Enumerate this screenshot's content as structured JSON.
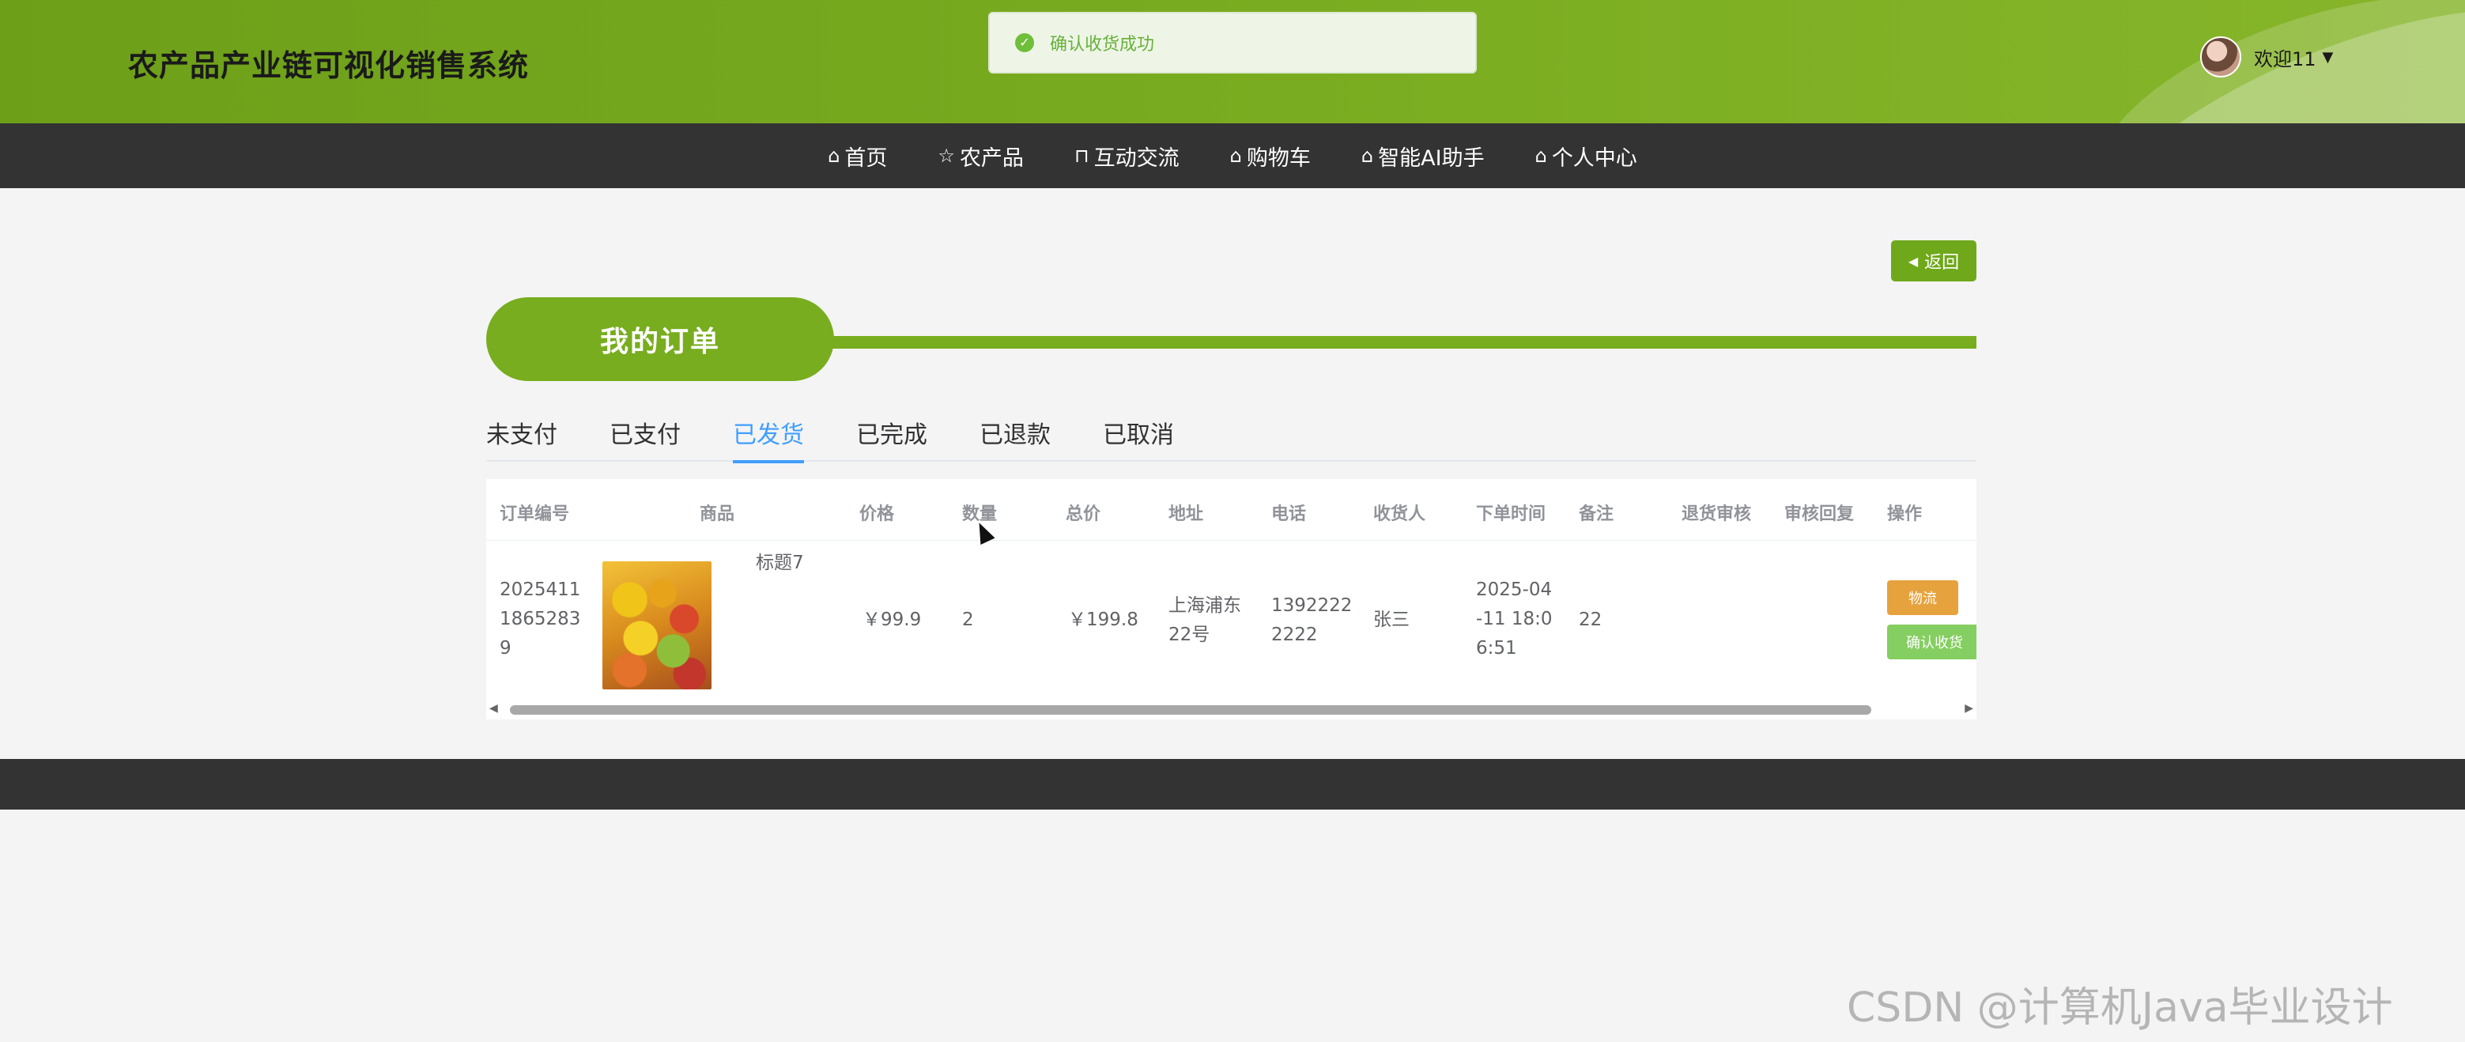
{
  "app": {
    "title": "农产品产业链可视化销售系统",
    "welcome": "欢迎11"
  },
  "toast": {
    "message": "确认收货成功",
    "icon": "check-circle-icon"
  },
  "nav": {
    "items": [
      {
        "label": "首页",
        "icon": "home-icon"
      },
      {
        "label": "农产品",
        "icon": "star-icon"
      },
      {
        "label": "互动交流",
        "icon": "bag-icon"
      },
      {
        "label": "购物车",
        "icon": "home-icon"
      },
      {
        "label": "智能AI助手",
        "icon": "home-icon"
      },
      {
        "label": "个人中心",
        "icon": "home-icon"
      }
    ]
  },
  "page": {
    "back_label": "返回",
    "title": "我的订单"
  },
  "tabs": [
    {
      "label": "未支付",
      "active": false
    },
    {
      "label": "已支付",
      "active": false
    },
    {
      "label": "已发货",
      "active": true
    },
    {
      "label": "已完成",
      "active": false
    },
    {
      "label": "已退款",
      "active": false
    },
    {
      "label": "已取消",
      "active": false
    }
  ],
  "table": {
    "headers": [
      "订单编号",
      "商品",
      "价格",
      "数量",
      "总价",
      "地址",
      "电话",
      "收货人",
      "下单时间",
      "备注",
      "退货审核",
      "审核回复",
      "操作"
    ],
    "rows": [
      {
        "order_no_lines": [
          "2025411",
          "1865283",
          "9"
        ],
        "product_name": "标题7",
        "price": "￥99.9",
        "quantity": "2",
        "total": "￥199.8",
        "address_lines": [
          "上海浦东",
          "22号"
        ],
        "phone_lines": [
          "1392222",
          "2222"
        ],
        "receiver": "张三",
        "time_lines": [
          "2025-04",
          "-11 18:0",
          "6:51"
        ],
        "remark": "22",
        "return_review": "",
        "review_reply": "",
        "actions": {
          "logistics": "物流",
          "confirm": "确认收货"
        }
      }
    ]
  },
  "watermark": "CSDN @计算机Java毕业设计",
  "colors": {
    "brand_green": "#78ad1f",
    "nav_bg": "#333333",
    "active_tab": "#409eff",
    "logistics_btn": "#e6a23c",
    "confirm_btn": "#85ce61"
  }
}
